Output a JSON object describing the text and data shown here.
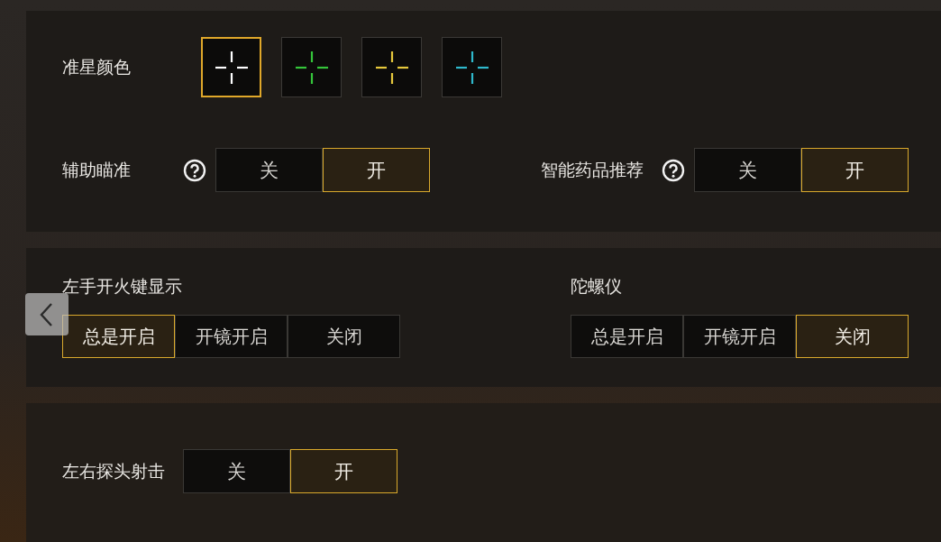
{
  "panels": [
    {
      "rows": [
        {
          "settings": [
            {
              "kind": "swatches",
              "label": "准星颜色",
              "options": [
                {
                  "color": "#ffffff",
                  "selected": true
                },
                {
                  "color": "#35c53a",
                  "selected": false
                },
                {
                  "color": "#e6c83c",
                  "selected": false
                },
                {
                  "color": "#2fb9cc",
                  "selected": false
                }
              ]
            }
          ]
        },
        {
          "settings": [
            {
              "kind": "inline",
              "label": "辅助瞄准",
              "help": true,
              "options": [
                {
                  "label": "关",
                  "selected": false
                },
                {
                  "label": "开",
                  "selected": true
                }
              ]
            },
            {
              "kind": "inline",
              "label": "智能药品推荐",
              "help": true,
              "options": [
                {
                  "label": "关",
                  "selected": false
                },
                {
                  "label": "开",
                  "selected": true
                }
              ]
            }
          ]
        }
      ]
    },
    {
      "rows": [
        {
          "settings": [
            {
              "kind": "stacked",
              "label": "左手开火键显示",
              "options": [
                {
                  "label": "总是开启",
                  "selected": true
                },
                {
                  "label": "开镜开启",
                  "selected": false
                },
                {
                  "label": "关闭",
                  "selected": false
                }
              ]
            },
            {
              "kind": "stacked",
              "label": "陀螺仪",
              "options": [
                {
                  "label": "总是开启",
                  "selected": false
                },
                {
                  "label": "开镜开启",
                  "selected": false
                },
                {
                  "label": "关闭",
                  "selected": true
                }
              ]
            }
          ]
        }
      ]
    },
    {
      "rows": [
        {
          "settings": [
            {
              "kind": "inline",
              "label": "左右探头射击",
              "help": false,
              "options": [
                {
                  "label": "关",
                  "selected": false
                },
                {
                  "label": "开",
                  "selected": true
                }
              ]
            }
          ]
        }
      ]
    }
  ]
}
